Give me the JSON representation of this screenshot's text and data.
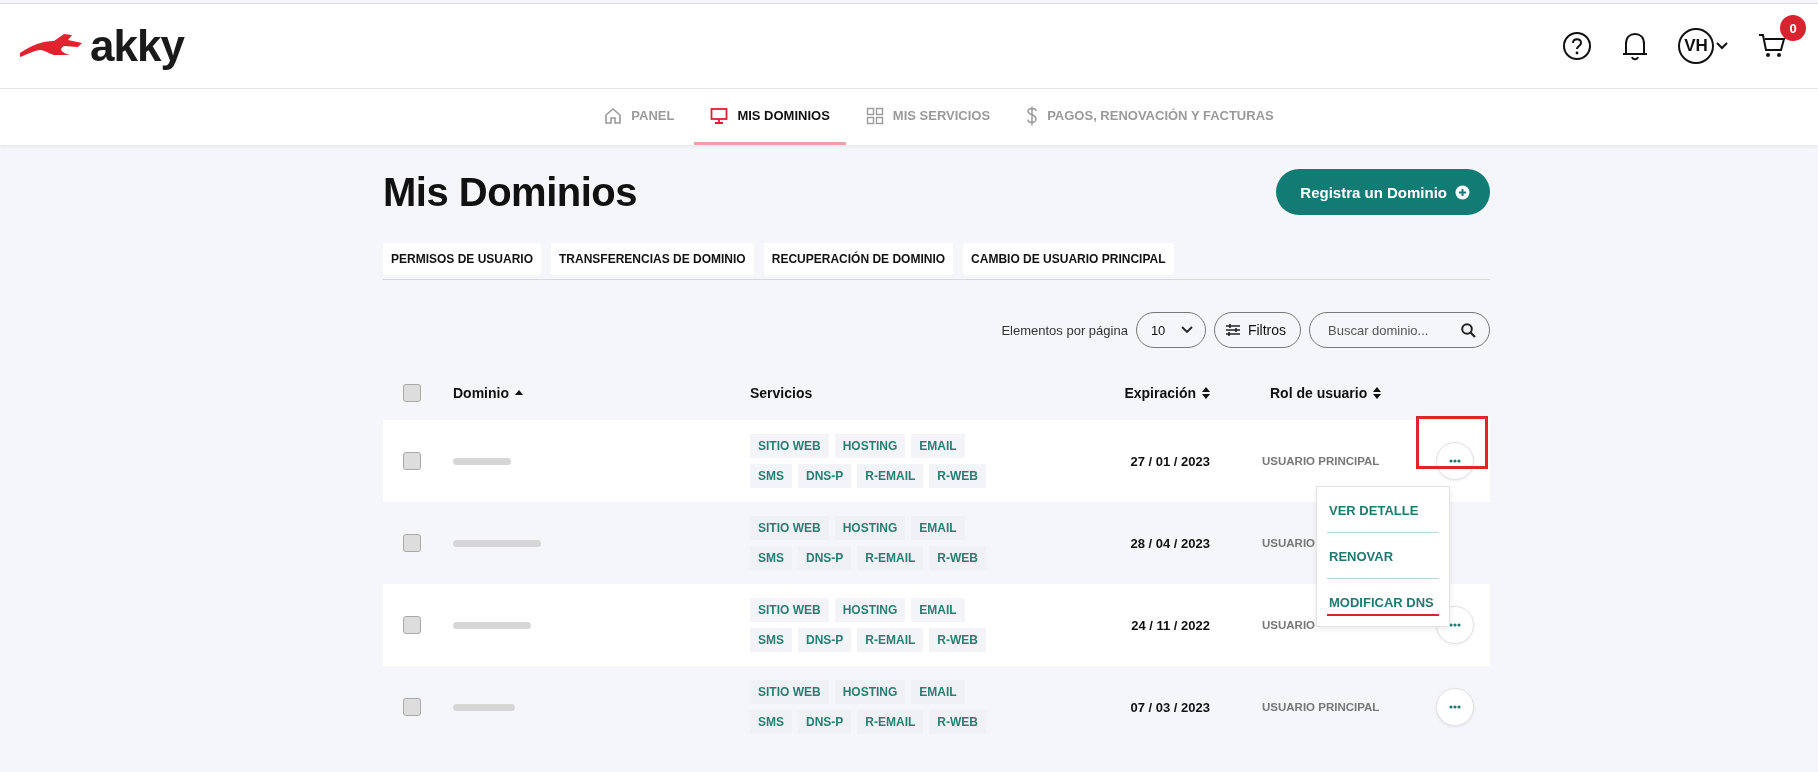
{
  "header": {
    "logo": "akky",
    "user_initials": "VH",
    "cart_count": "0"
  },
  "nav": {
    "tabs": [
      {
        "label": "PANEL",
        "selected": false
      },
      {
        "label": "MIS DOMINIOS",
        "selected": true
      },
      {
        "label": "MIS SERVICIOS",
        "selected": false
      },
      {
        "label": "PAGOS, RENOVACIÓN Y FACTURAS",
        "selected": false
      }
    ]
  },
  "page": {
    "title": "Mis Dominios",
    "primary_button": "Registra un Dominio",
    "sub_tabs": [
      "PERMISOS DE USUARIO",
      "TRANSFERENCIAS DE DOMINIO",
      "RECUPERACIÓN DE DOMINIO",
      "CAMBIO DE USUARIO PRINCIPAL"
    ],
    "toolbar": {
      "per_page_label": "Elementos por página",
      "per_page_value": "10",
      "filter_button": "Filtros",
      "search": {
        "placeholder": "Buscar dominio..."
      }
    }
  },
  "table": {
    "select_all": {
      "checked": false
    },
    "columns": [
      {
        "label": "Dominio"
      },
      {
        "label": "Servicios"
      },
      {
        "label": "Expiración"
      },
      {
        "label": "Rol de usuario"
      }
    ],
    "rows": [
      {
        "checked": false,
        "services": [
          "SITIO WEB",
          "HOSTING",
          "EMAIL",
          "SMS",
          "DNS-P",
          "R-EMAIL",
          "R-WEB"
        ],
        "expiration": "27 / 01 / 2023",
        "role": "USUARIO PRINCIPAL",
        "action_visible": true,
        "action_highlighted": true,
        "menu_open": true,
        "menu": [
          {
            "label": "VER DETALLE",
            "highlighted": false
          },
          {
            "label": "RENOVAR",
            "highlighted": false
          },
          {
            "label": "MODIFICAR DNS",
            "highlighted": true
          }
        ]
      },
      {
        "checked": false,
        "services": [
          "SITIO WEB",
          "HOSTING",
          "EMAIL",
          "SMS",
          "DNS-P",
          "R-EMAIL",
          "R-WEB"
        ],
        "expiration": "28 / 04 / 2023",
        "role": "USUARIO",
        "action_visible": false,
        "action_highlighted": false,
        "menu_open": false
      },
      {
        "checked": false,
        "services": [
          "SITIO WEB",
          "HOSTING",
          "EMAIL",
          "SMS",
          "DNS-P",
          "R-EMAIL",
          "R-WEB"
        ],
        "expiration": "24 / 11 / 2022",
        "role": "USUARIO",
        "action_visible": true,
        "action_highlighted": false,
        "menu_open": false
      },
      {
        "checked": false,
        "services": [
          "SITIO WEB",
          "HOSTING",
          "EMAIL",
          "SMS",
          "DNS-P",
          "R-EMAIL",
          "R-WEB"
        ],
        "expiration": "07 / 03 / 2023",
        "role": "USUARIO PRINCIPAL",
        "action_visible": true,
        "action_highlighted": false,
        "menu_open": false
      }
    ]
  }
}
